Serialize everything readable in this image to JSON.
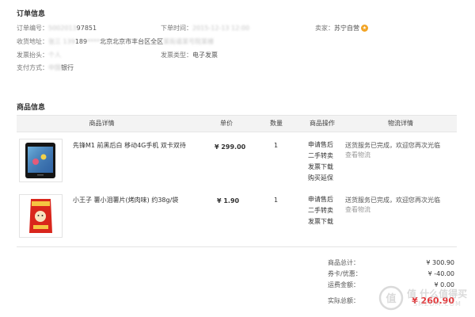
{
  "order_info": {
    "title": "订单信息",
    "order_no_label": "订单编号：",
    "order_no_value": "97851",
    "order_time_label": "下单时间：",
    "seller_label": "卖家：",
    "seller_value": "苏宁自营",
    "address_label": "收货地址：",
    "address_value": "189",
    "address_text": "北京北京市丰台区全区",
    "delivery_label": "发票抬头：",
    "invoice_type_label": "发票类型：",
    "invoice_type_value": "电子发票",
    "payment_label": "支付方式：",
    "payment_value": "银行"
  },
  "goods_info": {
    "title": "商品信息",
    "columns": [
      "商品详情",
      "单价",
      "数量",
      "商品操作",
      "物流详情"
    ],
    "items": [
      {
        "name": "先锋M1 前黑后白 移动4G手机 双卡双待",
        "price": "¥ 299.00",
        "qty": "1",
        "ops": [
          "申请售后",
          "二手转卖",
          "发票下载",
          "购买延保"
        ],
        "logistics_text": "送货服务已完成，欢迎您再次光临",
        "logistics_link": "查看物流"
      },
      {
        "name": "小王子 薯小泪薯片(烤肉味) 约38g/袋",
        "price": "¥ 1.90",
        "qty": "1",
        "ops": [
          "申请售后",
          "二手转卖",
          "发票下载"
        ],
        "logistics_text": "送货服务已完成，欢迎您再次光临",
        "logistics_link": "查看物流"
      }
    ]
  },
  "summary": {
    "goods_total_label": "商品总计：",
    "goods_total_value": "¥ 300.90",
    "coupon_label": "券卡/优惠：",
    "coupon_value": "¥ -40.00",
    "shipping_label": "运费金额：",
    "shipping_value": "¥ 0.00",
    "paid_label": "实际总额：",
    "paid_value": "¥ 260.90"
  },
  "watermark": {
    "text_cn": "值 什么值得买",
    "text_en": "SMZDM.COM"
  },
  "colors": {
    "accent_red": "#e4393c",
    "badge_orange": "#f2a425"
  }
}
